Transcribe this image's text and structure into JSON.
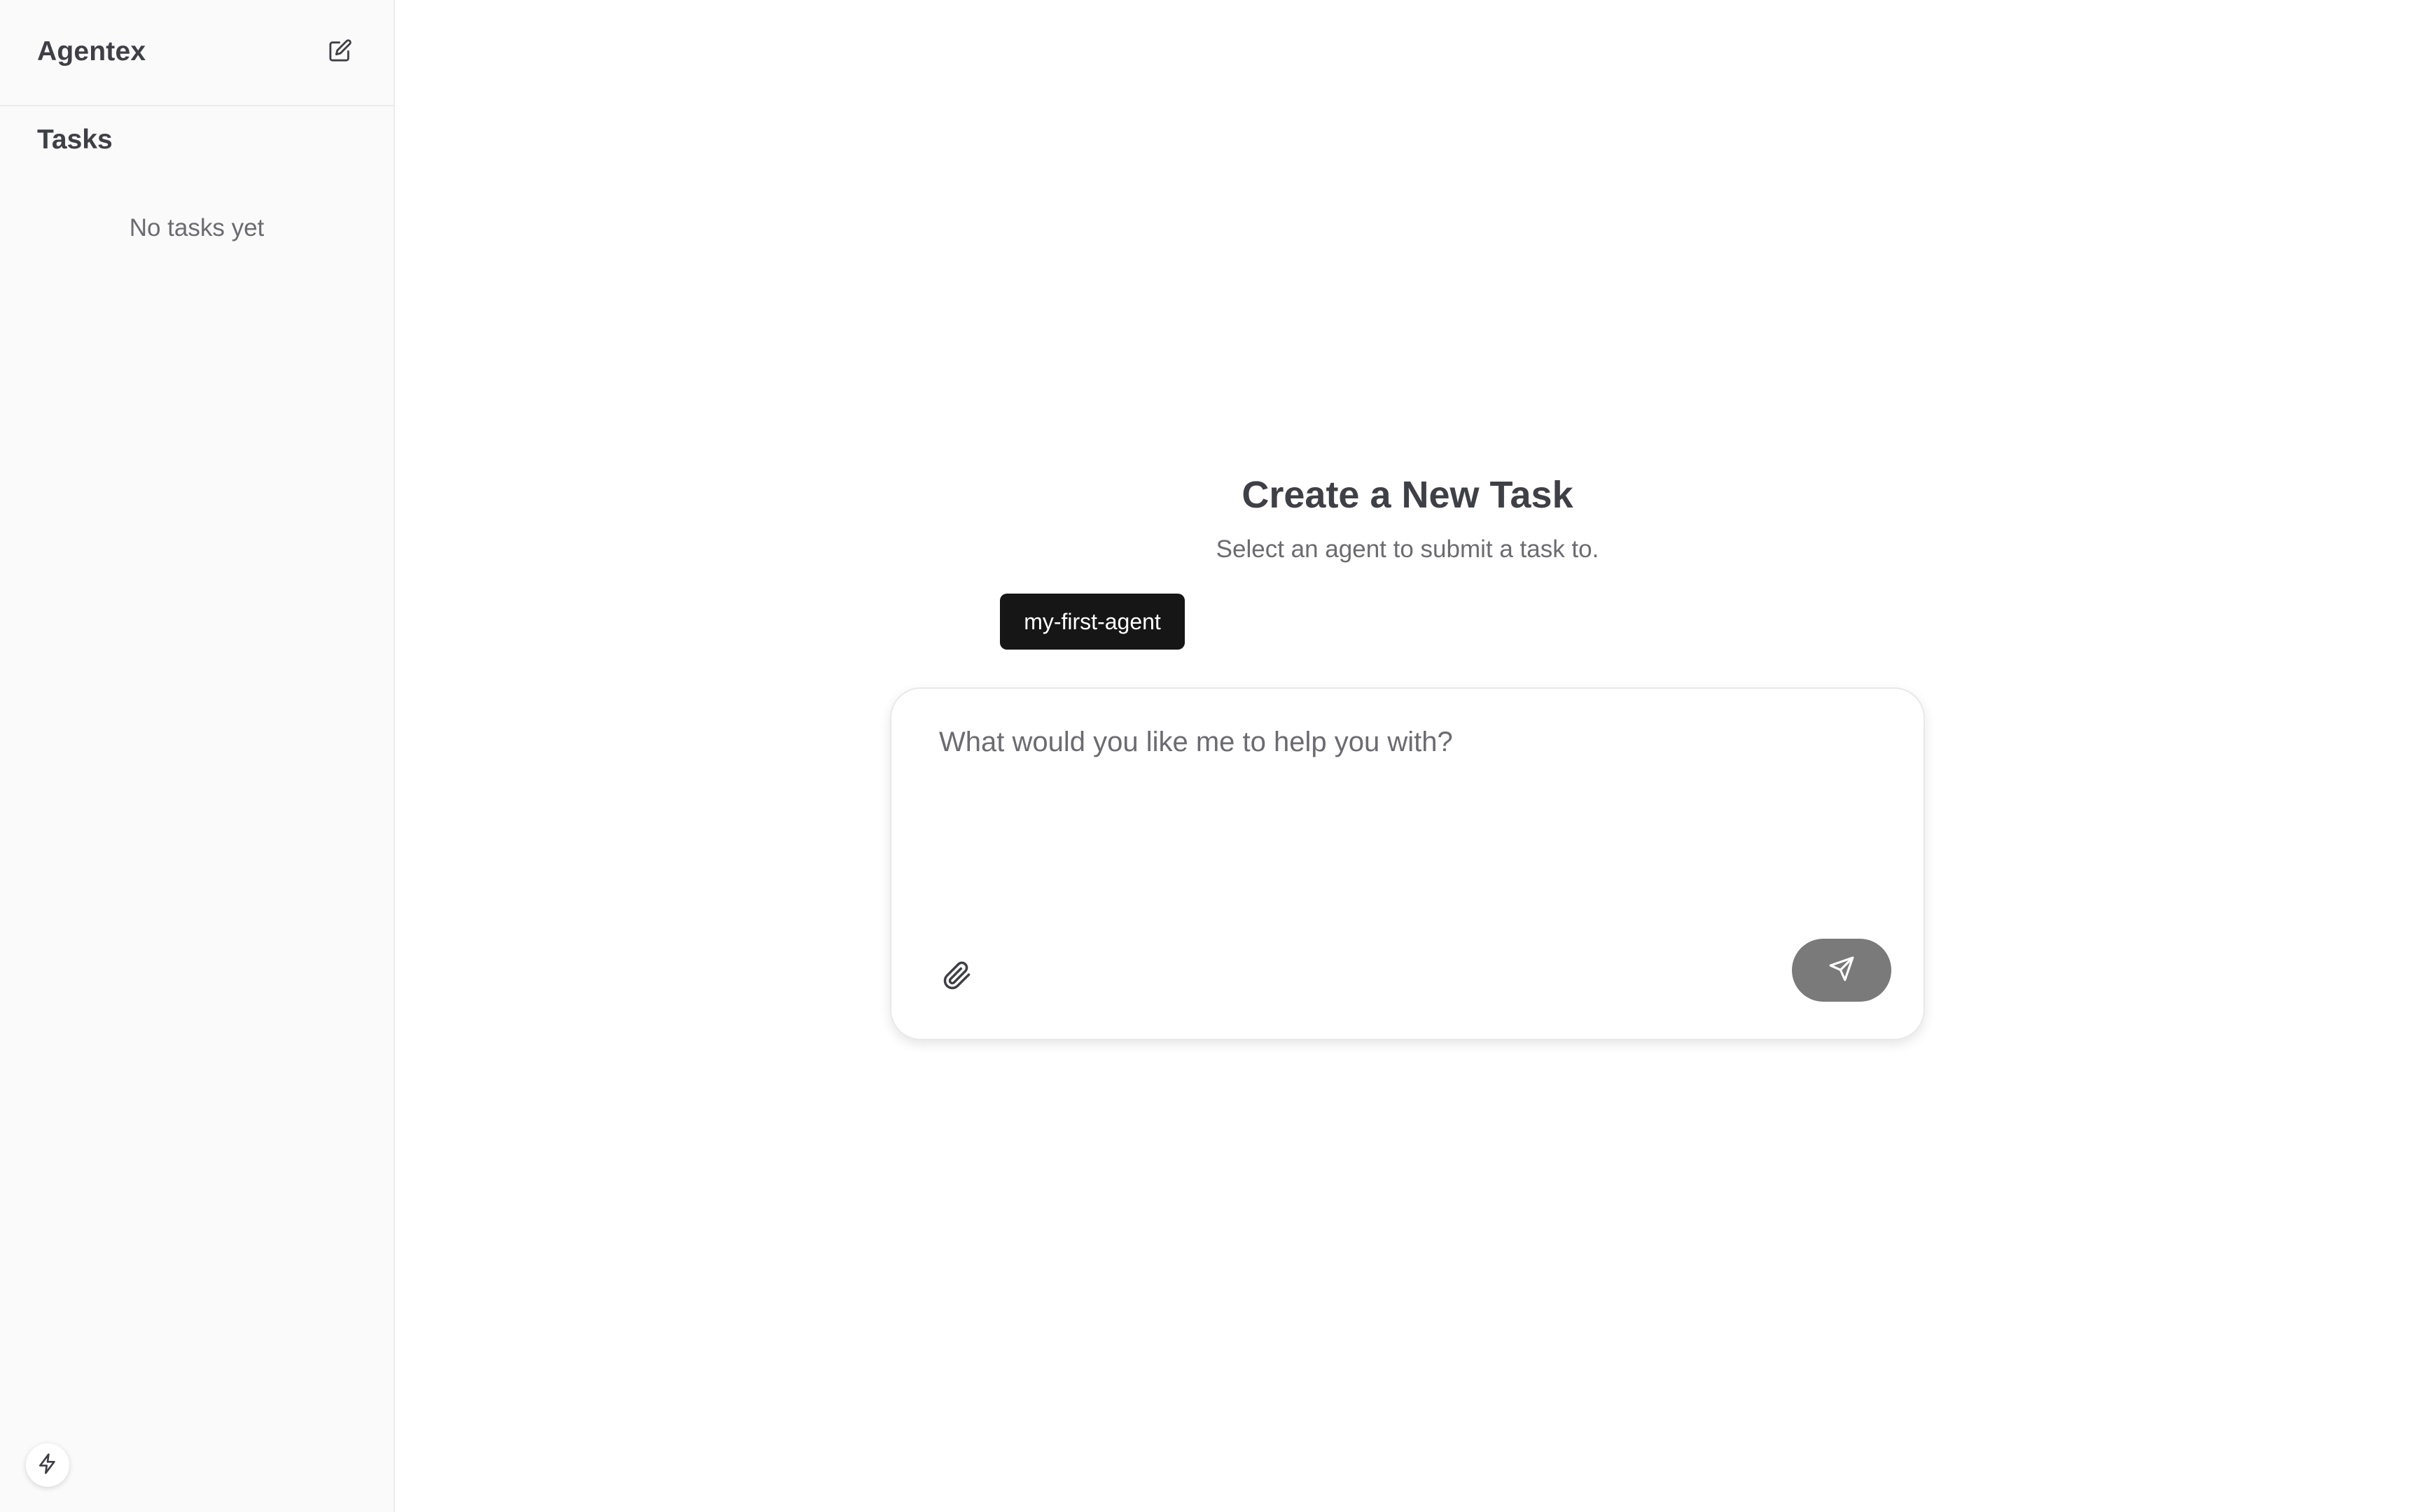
{
  "sidebar": {
    "app_title": "Agentex",
    "new_task_icon": "edit-icon",
    "tasks_heading": "Tasks",
    "empty_message": "No tasks yet",
    "bottom_icon": "bolt-icon"
  },
  "main": {
    "title": "Create a New Task",
    "subtitle": "Select an agent to submit a task to.",
    "agents": [
      {
        "label": "my-first-agent"
      }
    ]
  },
  "composer": {
    "placeholder": "What would you like me to help you with?",
    "value": "",
    "attach_icon": "paperclip-icon",
    "send_icon": "send-icon"
  },
  "colors": {
    "sidebar_bg": "#fafafa",
    "text_primary": "#3f3f46",
    "text_muted": "#6b6b70",
    "chip_bg": "#161616",
    "send_button_bg": "#7a7a7a"
  }
}
